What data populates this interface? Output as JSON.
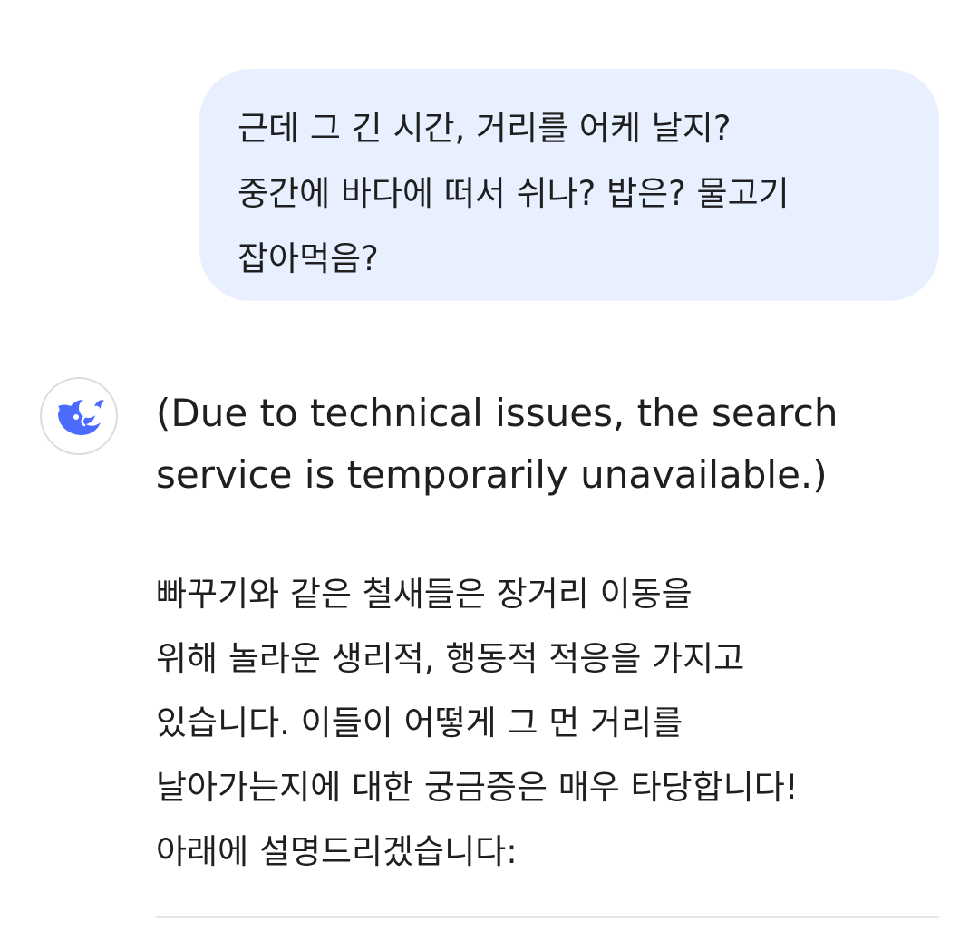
{
  "user_message": {
    "lines": [
      "근데 그 긴 시간, 거리를 어케 날지?",
      "중간에 바다에 떠서 쉬나? 밥은? 물고기",
      "잡아먹음?"
    ]
  },
  "assistant": {
    "avatar_icon": "deepseek-whale-icon",
    "accent_color": "#4d6bfe",
    "notice_lines": [
      "(Due to technical issues, the search",
      "service is temporarily unavailable.)"
    ],
    "answer_lines": [
      "빠꾸기와 같은 철새들은 장거리 이동을",
      "위해 놀라운 생리적, 행동적 적응을 가지고",
      "있습니다. 이들이 어떻게 그 먼 거리를",
      "날아가는지에 대한 궁금증은 매우 타당합니다!",
      "아래에 설명드리겠습니다:"
    ]
  },
  "colors": {
    "user_bubble_bg": "#e8efff",
    "text": "#1f1f1f"
  }
}
